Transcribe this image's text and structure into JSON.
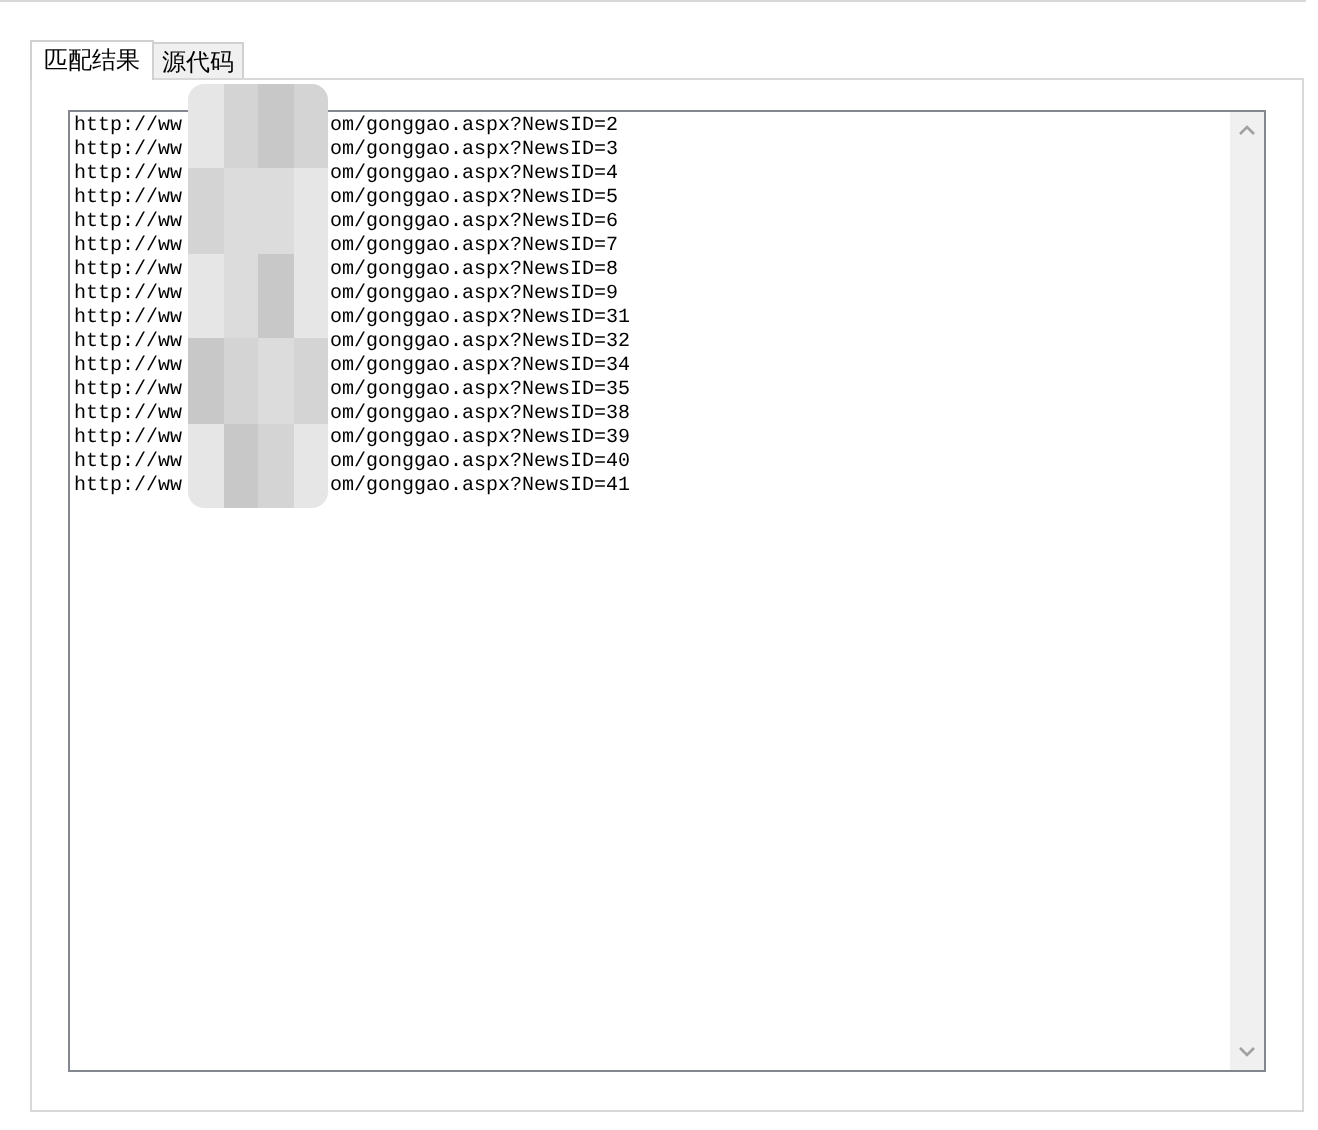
{
  "tabs": [
    {
      "label": "匹配结果",
      "selected": true
    },
    {
      "label": "源代码",
      "selected": false
    }
  ],
  "results": [
    {
      "start": "http://ww",
      "end": "om/gonggao.aspx?NewsID=2"
    },
    {
      "start": "http://ww",
      "end": "om/gonggao.aspx?NewsID=3"
    },
    {
      "start": "http://ww",
      "end": "om/gonggao.aspx?NewsID=4"
    },
    {
      "start": "http://ww",
      "end": "om/gonggao.aspx?NewsID=5"
    },
    {
      "start": "http://ww",
      "end": "om/gonggao.aspx?NewsID=6"
    },
    {
      "start": "http://ww",
      "end": "om/gonggao.aspx?NewsID=7"
    },
    {
      "start": "http://ww",
      "end": "om/gonggao.aspx?NewsID=8"
    },
    {
      "start": "http://ww",
      "end": "om/gonggao.aspx?NewsID=9"
    },
    {
      "start": "http://ww",
      "end": "om/gonggao.aspx?NewsID=31"
    },
    {
      "start": "http://ww",
      "end": "om/gonggao.aspx?NewsID=32"
    },
    {
      "start": "http://ww",
      "end": "om/gonggao.aspx?NewsID=34"
    },
    {
      "start": "http://ww",
      "end": "om/gonggao.aspx?NewsID=35"
    },
    {
      "start": "http://ww",
      "end": "om/gonggao.aspx?NewsID=38"
    },
    {
      "start": "http://ww",
      "end": "om/gonggao.aspx?NewsID=39"
    },
    {
      "start": "http://ww",
      "end": "om/gonggao.aspx?NewsID=40"
    },
    {
      "start": "http://ww",
      "end": "om/gonggao.aspx?NewsID=41"
    }
  ]
}
